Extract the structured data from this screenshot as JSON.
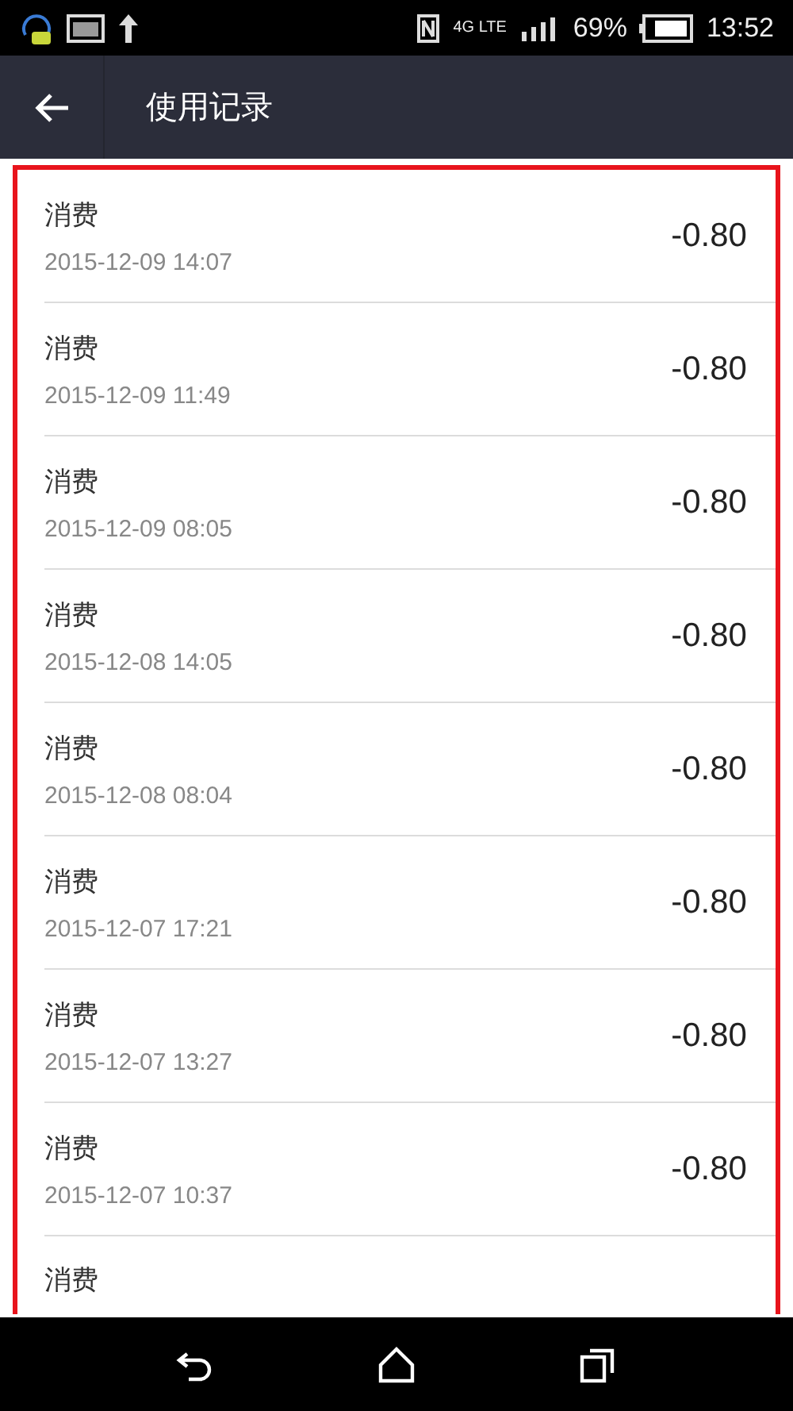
{
  "status_bar": {
    "network": "4G LTE",
    "battery": "69%",
    "time": "13:52"
  },
  "app_bar": {
    "title": "使用记录"
  },
  "records": [
    {
      "title": "消费",
      "date": "2015-12-09 14:07",
      "amount": "-0.80"
    },
    {
      "title": "消费",
      "date": "2015-12-09 11:49",
      "amount": "-0.80"
    },
    {
      "title": "消费",
      "date": "2015-12-09 08:05",
      "amount": "-0.80"
    },
    {
      "title": "消费",
      "date": "2015-12-08 14:05",
      "amount": "-0.80"
    },
    {
      "title": "消费",
      "date": "2015-12-08 08:04",
      "amount": "-0.80"
    },
    {
      "title": "消费",
      "date": "2015-12-07 17:21",
      "amount": "-0.80"
    },
    {
      "title": "消费",
      "date": "2015-12-07 13:27",
      "amount": "-0.80"
    },
    {
      "title": "消费",
      "date": "2015-12-07 10:37",
      "amount": "-0.80"
    },
    {
      "title": "消费"
    }
  ]
}
